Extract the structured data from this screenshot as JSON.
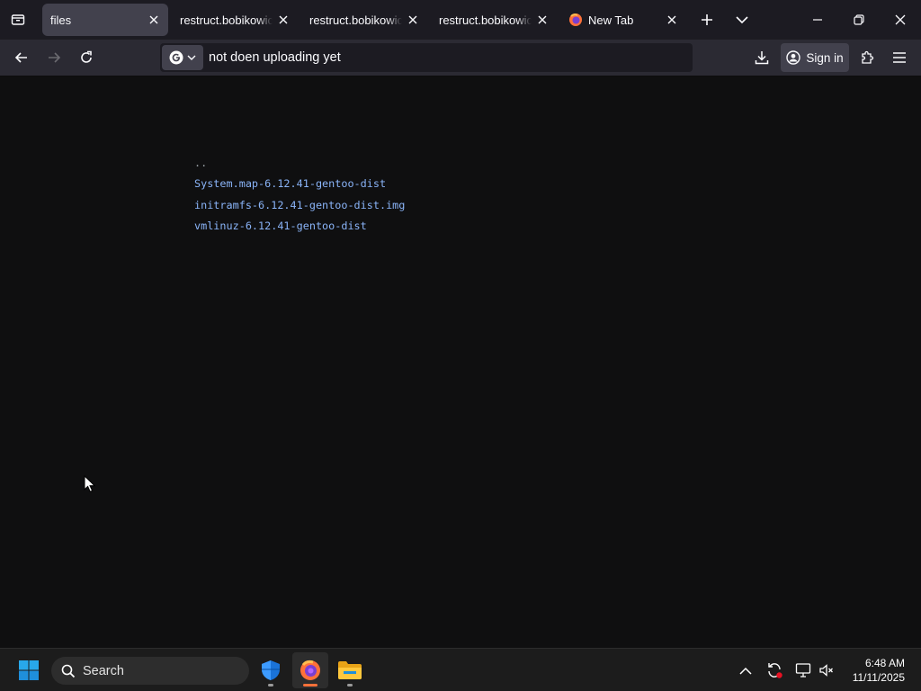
{
  "tabs": [
    {
      "label": "files",
      "active": true
    },
    {
      "label": "restruct.bobikowice.p",
      "active": false
    },
    {
      "label": "restruct.bobikowice.p",
      "active": false
    },
    {
      "label": "restruct.bobikowice.p",
      "active": false
    },
    {
      "label": "New Tab",
      "active": false
    }
  ],
  "navbar": {
    "url_text": "not doen uploading yet",
    "signin_label": "Sign in"
  },
  "listing": {
    "parent": "..",
    "files": [
      "System.map-6.12.41-gentoo-dist",
      "initramfs-6.12.41-gentoo-dist.img",
      "vmlinuz-6.12.41-gentoo-dist"
    ]
  },
  "taskbar": {
    "search_label": "Search",
    "time": "6:48 AM",
    "date": "11/11/2025"
  },
  "colors": {
    "link": "#8ab4f8",
    "accent": "#0078d4",
    "firefox_indicator": "#ff7139"
  }
}
